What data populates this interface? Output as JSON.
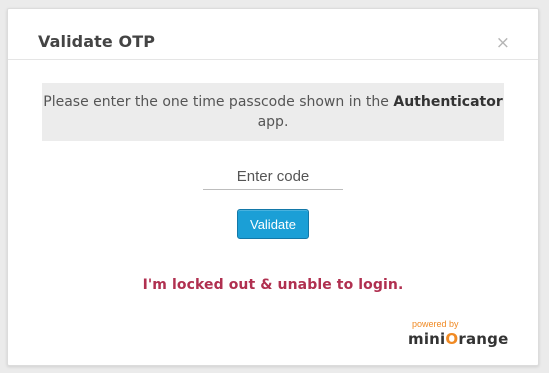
{
  "modal": {
    "title": "Validate OTP",
    "close_label": "×",
    "message_prefix": "Please enter the one time passcode shown in the",
    "message_app_name": "Authenticator",
    "message_suffix": "app.",
    "code_placeholder": "Enter code",
    "code_value": "",
    "validate_label": "Validate",
    "locked_out_link": "I'm locked out & unable to login."
  },
  "branding": {
    "powered_by": "powered by",
    "name_prefix": "mini",
    "name_o": "O",
    "name_suffix": "range"
  },
  "colors": {
    "accent_button": "#1b9fd6",
    "link_red": "#b03050",
    "brand_orange": "#f08a24"
  }
}
